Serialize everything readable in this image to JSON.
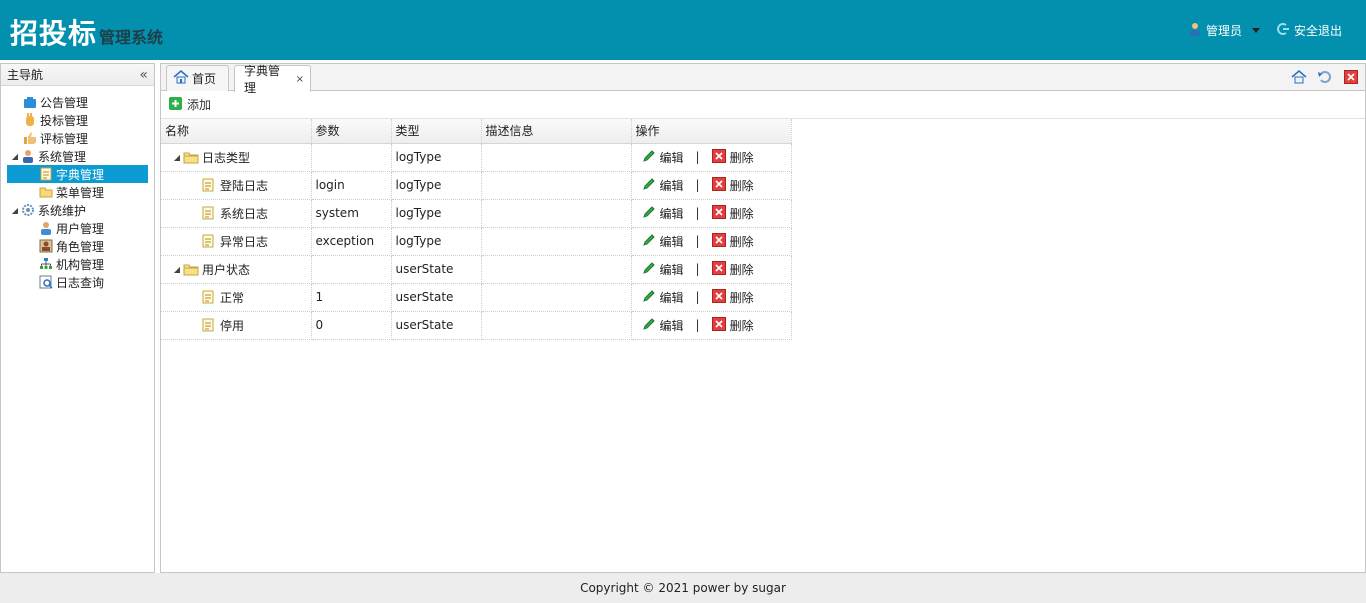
{
  "header": {
    "brand_main": "招投标",
    "brand_sub": "管理系统",
    "user_label": "管理员",
    "logout_label": "安全退出"
  },
  "sidebar": {
    "title": "主导航",
    "nodes": [
      {
        "label": "公告管理",
        "icon": "notice-icon"
      },
      {
        "label": "投标管理",
        "icon": "hand-icon"
      },
      {
        "label": "评标管理",
        "icon": "thumbs-up-icon"
      },
      {
        "label": "系统管理",
        "icon": "user-admin-icon"
      },
      {
        "label": "字典管理",
        "icon": "document-icon"
      },
      {
        "label": "菜单管理",
        "icon": "folder-icon"
      },
      {
        "label": "系统维护",
        "icon": "gear-icon"
      },
      {
        "label": "用户管理",
        "icon": "user-icon"
      },
      {
        "label": "角色管理",
        "icon": "role-icon"
      },
      {
        "label": "机构管理",
        "icon": "org-chart-icon"
      },
      {
        "label": "日志查询",
        "icon": "log-search-icon"
      }
    ]
  },
  "tabs": [
    {
      "label": "首页",
      "icon": "home-icon"
    },
    {
      "label": "字典管理",
      "close": "×"
    }
  ],
  "toolbar": {
    "add_label": "添加"
  },
  "grid": {
    "columns": [
      "名称",
      "参数",
      "类型",
      "描述信息",
      "操作"
    ],
    "edit_label": "编辑",
    "delete_label": "删除",
    "separator": "|",
    "rows": [
      {
        "name": "日志类型",
        "param": "",
        "type": "logType",
        "desc": "",
        "level": 0
      },
      {
        "name": "登陆日志",
        "param": "login",
        "type": "logType",
        "desc": "",
        "level": 1
      },
      {
        "name": "系统日志",
        "param": "system",
        "type": "logType",
        "desc": "",
        "level": 1
      },
      {
        "name": "异常日志",
        "param": "exception",
        "type": "logType",
        "desc": "",
        "level": 1
      },
      {
        "name": "用户状态",
        "param": "",
        "type": "userState",
        "desc": "",
        "level": 0
      },
      {
        "name": "正常",
        "param": "1",
        "type": "userState",
        "desc": "",
        "level": 1
      },
      {
        "name": "停用",
        "param": "0",
        "type": "userState",
        "desc": "",
        "level": 1
      }
    ]
  },
  "footer": {
    "text": "Copyright © 2021 power by sugar"
  },
  "colors": {
    "header_bg": "#0290ae",
    "selected_bg": "#0c9bd3",
    "edit_green": "#2e9b2e",
    "delete_red": "#d9302c"
  }
}
